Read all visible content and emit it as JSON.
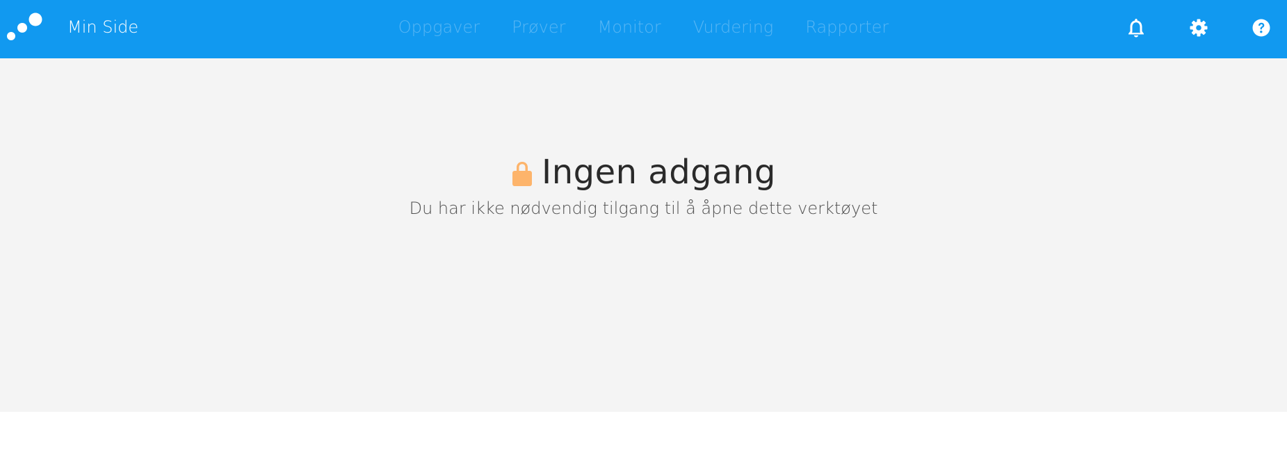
{
  "header": {
    "brand_label": "Min Side",
    "nav": [
      {
        "label": "Oppgaver"
      },
      {
        "label": "Prøver"
      },
      {
        "label": "Monitor"
      },
      {
        "label": "Vurdering"
      },
      {
        "label": "Rapporter"
      }
    ],
    "icons": [
      "bell-icon",
      "gear-icon",
      "help-icon"
    ]
  },
  "main": {
    "title": "Ingen adgang",
    "message": "Du har ikke nødvendig tilgang til å åpne dette verktøyet",
    "lock_icon": "lock-icon"
  },
  "colors": {
    "header_bg": "#1199f0",
    "nav_text": "#58b6f4",
    "content_bg": "#f4f4f4",
    "lock": "#fdb46b"
  }
}
